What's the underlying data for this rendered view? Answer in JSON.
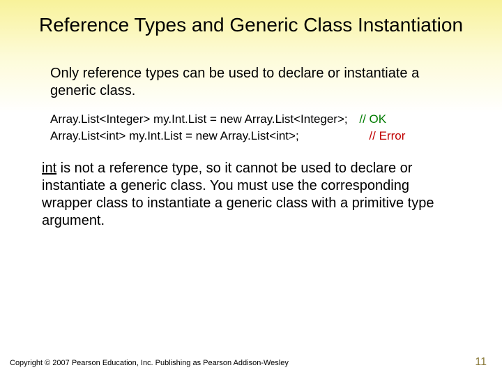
{
  "title": "Reference Types and Generic Class Instantiation",
  "para1": "Only reference types can be used to declare or instantiate a generic class.",
  "code": {
    "line1": "Array.List<Integer> my.Int.List = new Array.List<Integer>;",
    "comment1": "// OK",
    "line2": "Array.List<int> my.Int.List = new Array.List<int>;",
    "comment2": "// Error"
  },
  "para2_underlined": "int",
  "para2_rest": " is not a reference type, so it cannot be used to declare or instantiate a generic class.  You must use the corresponding wrapper class to instantiate a generic class with a primitive type argument.",
  "footer": "Copyright © 2007 Pearson Education, Inc. Publishing as Pearson Addison-Wesley",
  "pagenum": "11"
}
